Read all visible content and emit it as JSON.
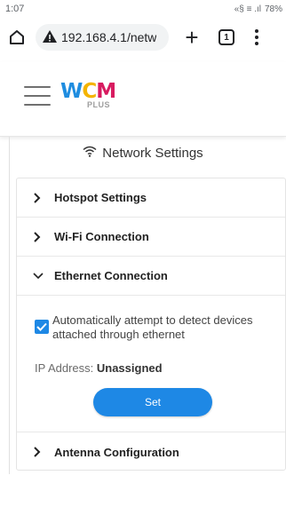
{
  "status_bar": {
    "time": "1:07",
    "icons_text": "«§ ≡ .ıl",
    "battery": "78%"
  },
  "browser": {
    "url": "192.168.4.1/netw",
    "tab_count": "1",
    "icons": [
      "home-icon",
      "not-secure-warning-icon",
      "new-tab-plus-icon",
      "tab-switcher-icon",
      "overflow-menu-icon"
    ]
  },
  "app": {
    "logo_main": "WCM",
    "logo_sub": "PLUS",
    "colors": {
      "logo_w": "#1f8de0",
      "logo_c": "#f4b400",
      "logo_m": "#d81b60",
      "accent": "#1e88e5"
    }
  },
  "page": {
    "title": "Network Settings",
    "sections": [
      {
        "label": "Hotspot Settings",
        "expanded": false
      },
      {
        "label": "Wi-Fi Connection",
        "expanded": false
      },
      {
        "label": "Ethernet Connection",
        "expanded": true
      },
      {
        "label": "Antenna Configuration",
        "expanded": false
      }
    ],
    "ethernet": {
      "auto_detect_label": "Automatically attempt to detect devices attached through ethernet",
      "auto_detect_checked": true,
      "ip_label": "IP Address:",
      "ip_value": "Unassigned",
      "set_button": "Set"
    }
  }
}
